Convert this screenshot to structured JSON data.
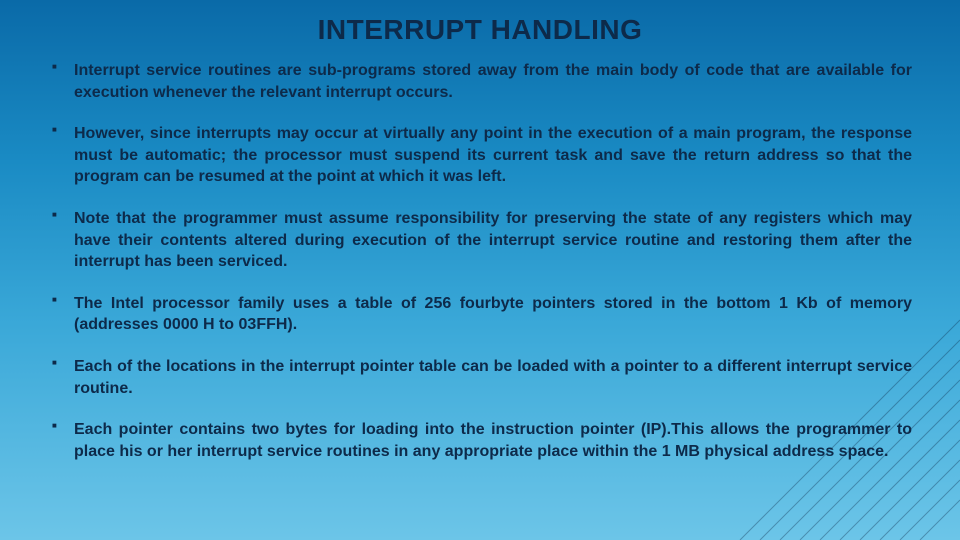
{
  "title": "INTERRUPT HANDLING",
  "bullets": [
    "Interrupt service routines are sub-programs stored away from the main body of code that are available for execution whenever the relevant interrupt occurs.",
    "However, since interrupts may occur at virtually any point in the execution of a main program, the response must be automatic; the processor must suspend its current task and save the return address so that the program can be resumed at the point at which it was left.",
    "Note that the programmer must assume responsibility for preserving the state of any registers which may have their contents altered during execution of the interrupt service routine and restoring them after the interrupt has been serviced.",
    "The Intel processor family uses a table of 256 fourbyte pointers stored in the bottom 1 Kb of memory (addresses 0000 H to 03FFH).",
    "Each of the locations in the interrupt pointer table can be loaded with a pointer to a different interrupt service routine.",
    "Each pointer contains two bytes for loading into the instruction pointer (IP).This allows the programmer to place his or her interrupt service routines in any appropriate place within the 1 MB physical address space."
  ]
}
